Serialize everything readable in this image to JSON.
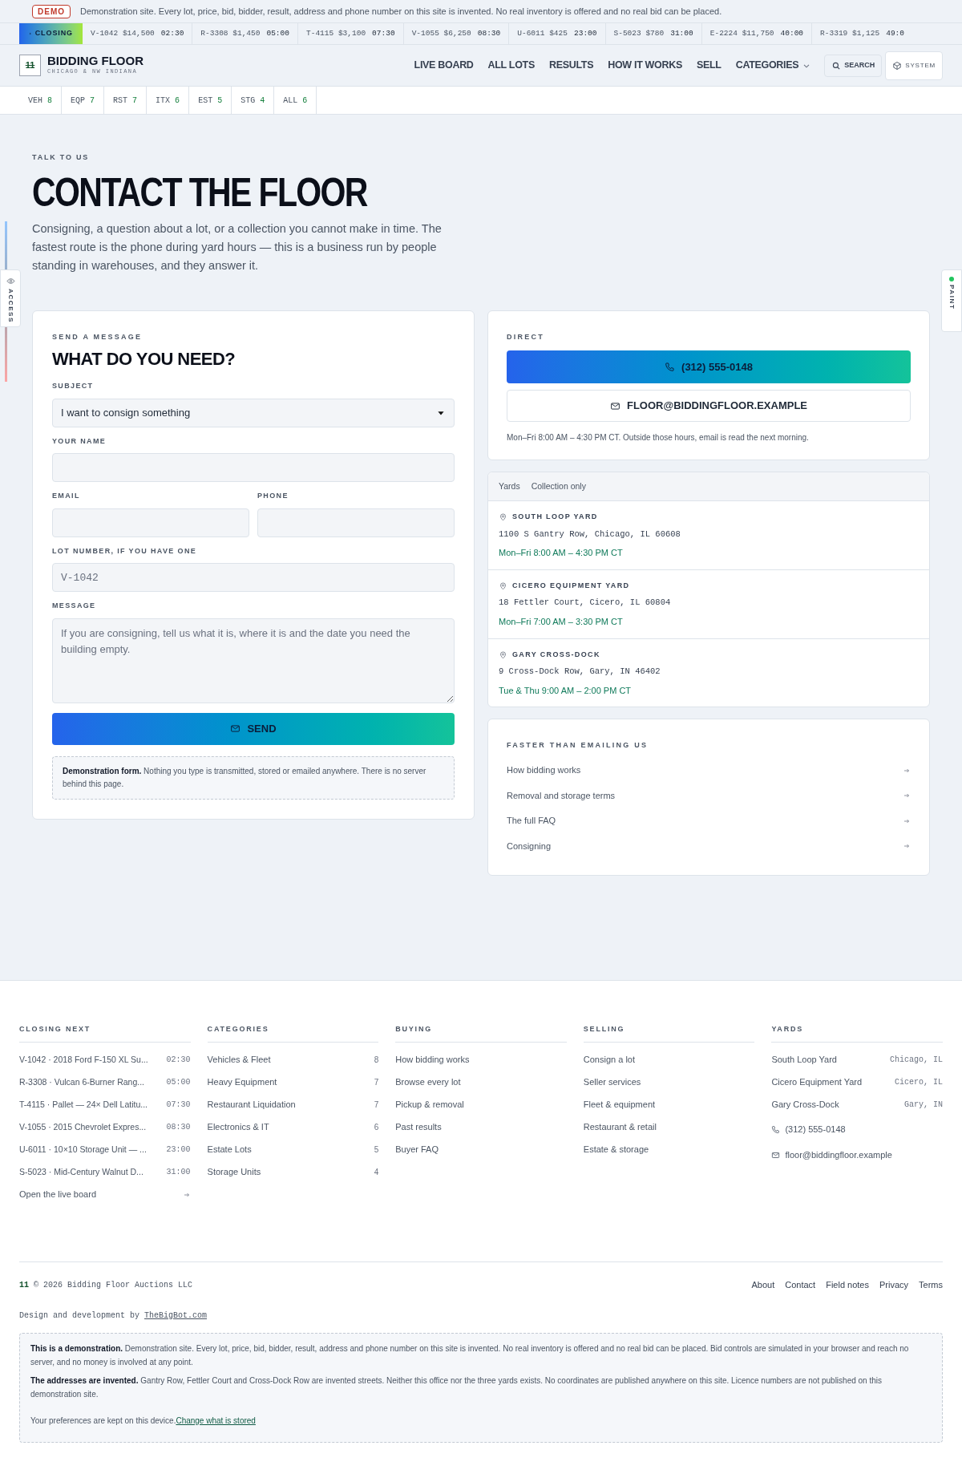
{
  "demo_banner": {
    "badge": "DEMO",
    "text": "Demonstration site. Every lot, price, bid, bidder, result, address and phone number on this site is invented. No real inventory is offered and no real bid can be placed."
  },
  "ticker": {
    "label": "CLOSING",
    "items": [
      {
        "lot": "V-1042",
        "price": "$14,500",
        "time": "02:30"
      },
      {
        "lot": "R-3308",
        "price": "$1,450",
        "time": "05:00"
      },
      {
        "lot": "T-4115",
        "price": "$3,100",
        "time": "07:30"
      },
      {
        "lot": "V-1055",
        "price": "$6,250",
        "time": "08:30"
      },
      {
        "lot": "U-6011",
        "price": "$425",
        "time": "23:00"
      },
      {
        "lot": "S-5023",
        "price": "$780",
        "time": "31:00"
      },
      {
        "lot": "E-2224",
        "price": "$11,750",
        "time": "40:00"
      },
      {
        "lot": "R-3319",
        "price": "$1,125",
        "time": "49:0"
      }
    ]
  },
  "header": {
    "logo_mark": "11",
    "brand": "BIDDING FLOOR",
    "tagline": "CHICAGO & NW INDIANA",
    "nav": [
      {
        "label": "LIVE BOARD",
        "caret": false
      },
      {
        "label": "ALL LOTS",
        "caret": false
      },
      {
        "label": "RESULTS",
        "caret": false
      },
      {
        "label": "HOW IT WORKS",
        "caret": false
      },
      {
        "label": "SELL",
        "caret": false
      },
      {
        "label": "CATEGORIES",
        "caret": true
      }
    ],
    "search": "SEARCH",
    "system": "SYSTEM"
  },
  "category_tabs": [
    {
      "code": "VEH",
      "count": "8"
    },
    {
      "code": "EQP",
      "count": "7"
    },
    {
      "code": "RST",
      "count": "7"
    },
    {
      "code": "ITX",
      "count": "6"
    },
    {
      "code": "EST",
      "count": "5"
    },
    {
      "code": "STG",
      "count": "4"
    },
    {
      "code": "ALL",
      "count": "6"
    }
  ],
  "side_tabs": {
    "access": "ACCESS",
    "paint": "PAINT"
  },
  "hero": {
    "eyebrow": "TALK TO US",
    "title": "CONTACT THE FLOOR",
    "intro": "Consigning, a question about a lot, or a collection you cannot make in time. The fastest route is the phone during yard hours — this is a business run by people standing in warehouses, and they answer it."
  },
  "form": {
    "eyebrow": "SEND A MESSAGE",
    "title": "WHAT DO YOU NEED?",
    "rows": [
      {
        "fields": [
          {
            "kind": "select",
            "label": "SUBJECT",
            "value": "I want to consign something"
          }
        ]
      },
      {
        "fields": [
          {
            "kind": "text",
            "label": "YOUR NAME"
          }
        ]
      },
      {
        "fields": [
          {
            "kind": "text",
            "label": "EMAIL"
          },
          {
            "kind": "text",
            "label": "PHONE"
          }
        ]
      },
      {
        "fields": [
          {
            "kind": "text",
            "label": "LOT NUMBER, IF YOU HAVE ONE",
            "placeholder": "V-1042"
          }
        ]
      },
      {
        "fields": [
          {
            "kind": "textarea",
            "label": "MESSAGE",
            "placeholder": "If you are consigning, tell us what it is, where it is and the date you need the building empty."
          }
        ]
      }
    ],
    "send": "SEND",
    "notice": "**Demonstration form.** Nothing you type is transmitted, stored or emailed anywhere. There is no server behind this page."
  },
  "direct": {
    "eyebrow": "DIRECT",
    "phone": "(312) 555-0148",
    "email": "FLOOR@BIDDINGFLOOR.EXAMPLE",
    "note": "Mon–Fri 8:00 AM – 4:30 PM CT. Outside those hours, email is read the next morning."
  },
  "yards": {
    "headings": [
      "Yards",
      "Collection only"
    ],
    "items": [
      {
        "name": "SOUTH LOOP YARD",
        "address": "1100 S Gantry Row, Chicago, IL 60608",
        "hours": "Mon–Fri 8:00 AM – 4:30 PM CT"
      },
      {
        "name": "CICERO EQUIPMENT YARD",
        "address": "18 Fettler Court, Cicero, IL 60804",
        "hours": "Mon–Fri 7:00 AM – 3:30 PM CT"
      },
      {
        "name": "GARY CROSS-DOCK",
        "address": "9 Cross-Dock Row, Gary, IN 46402",
        "hours": "Tue & Thu 9:00 AM – 2:00 PM CT"
      }
    ]
  },
  "faster": {
    "title": "FASTER THAN EMAILING US",
    "links": [
      "How bidding works",
      "Removal and storage terms",
      "The full FAQ",
      "Consigning"
    ]
  },
  "footer": {
    "closing_next": {
      "title": "CLOSING NEXT",
      "items": [
        {
          "text": "V-1042 · 2018 Ford F-150 XL Su...",
          "time": "02:30"
        },
        {
          "text": "R-3308 · Vulcan 6-Burner Rang...",
          "time": "05:00"
        },
        {
          "text": "T-4115 · Pallet — 24× Dell Latitu...",
          "time": "07:30"
        },
        {
          "text": "V-1055 · 2015 Chevrolet Expres...",
          "time": "08:30"
        },
        {
          "text": "U-6011 · 10×10 Storage Unit — ...",
          "time": "23:00"
        },
        {
          "text": "S-5023 · Mid-Century Walnut D...",
          "time": "31:00"
        }
      ],
      "more": "Open the live board"
    },
    "categories": {
      "title": "CATEGORIES",
      "items": [
        {
          "label": "Vehicles & Fleet",
          "count": "8"
        },
        {
          "label": "Heavy Equipment",
          "count": "7"
        },
        {
          "label": "Restaurant Liquidation",
          "count": "7"
        },
        {
          "label": "Electronics & IT",
          "count": "6"
        },
        {
          "label": "Estate Lots",
          "count": "5"
        },
        {
          "label": "Storage Units",
          "count": "4"
        }
      ]
    },
    "buying": {
      "title": "BUYING",
      "links": [
        "How bidding works",
        "Browse every lot",
        "Pickup & removal",
        "Past results",
        "Buyer FAQ"
      ]
    },
    "selling": {
      "title": "SELLING",
      "links": [
        "Consign a lot",
        "Seller services",
        "Fleet & equipment",
        "Restaurant & retail",
        "Estate & storage"
      ]
    },
    "yards": {
      "title": "YARDS",
      "items": [
        {
          "name": "South Loop Yard",
          "city": "Chicago, IL"
        },
        {
          "name": "Cicero Equipment Yard",
          "city": "Cicero, IL"
        },
        {
          "name": "Gary Cross-Dock",
          "city": "Gary, IN"
        }
      ],
      "phone": "(312) 555-0148",
      "email": "floor@biddingfloor.example"
    }
  },
  "bottom": {
    "mark": "11",
    "copyright": "© 2026 Bidding Floor Auctions LLC",
    "links": [
      "About",
      "Contact",
      "Field notes",
      "Privacy",
      "Terms"
    ],
    "credit": "Design and development by",
    "credit_link": "TheBigBot.com",
    "disclaimers": [
      "**This is a demonstration.** Demonstration site. Every lot, price, bid, bidder, result, address and phone number on this site is invented. No real inventory is offered and no real bid can be placed. Bid controls are simulated in your browser and reach no server, and no money is involved at any point.",
      "**The addresses are invented.** Gantry Row, Fettler Court and Cross-Dock Row are invented streets. Neither this office nor the three yards exists. No coordinates are published anywhere on this site. Licence numbers are not published on this demonstration site."
    ],
    "prefs": "Your preferences are kept on this device.",
    "prefs_link": "Change what is stored"
  }
}
